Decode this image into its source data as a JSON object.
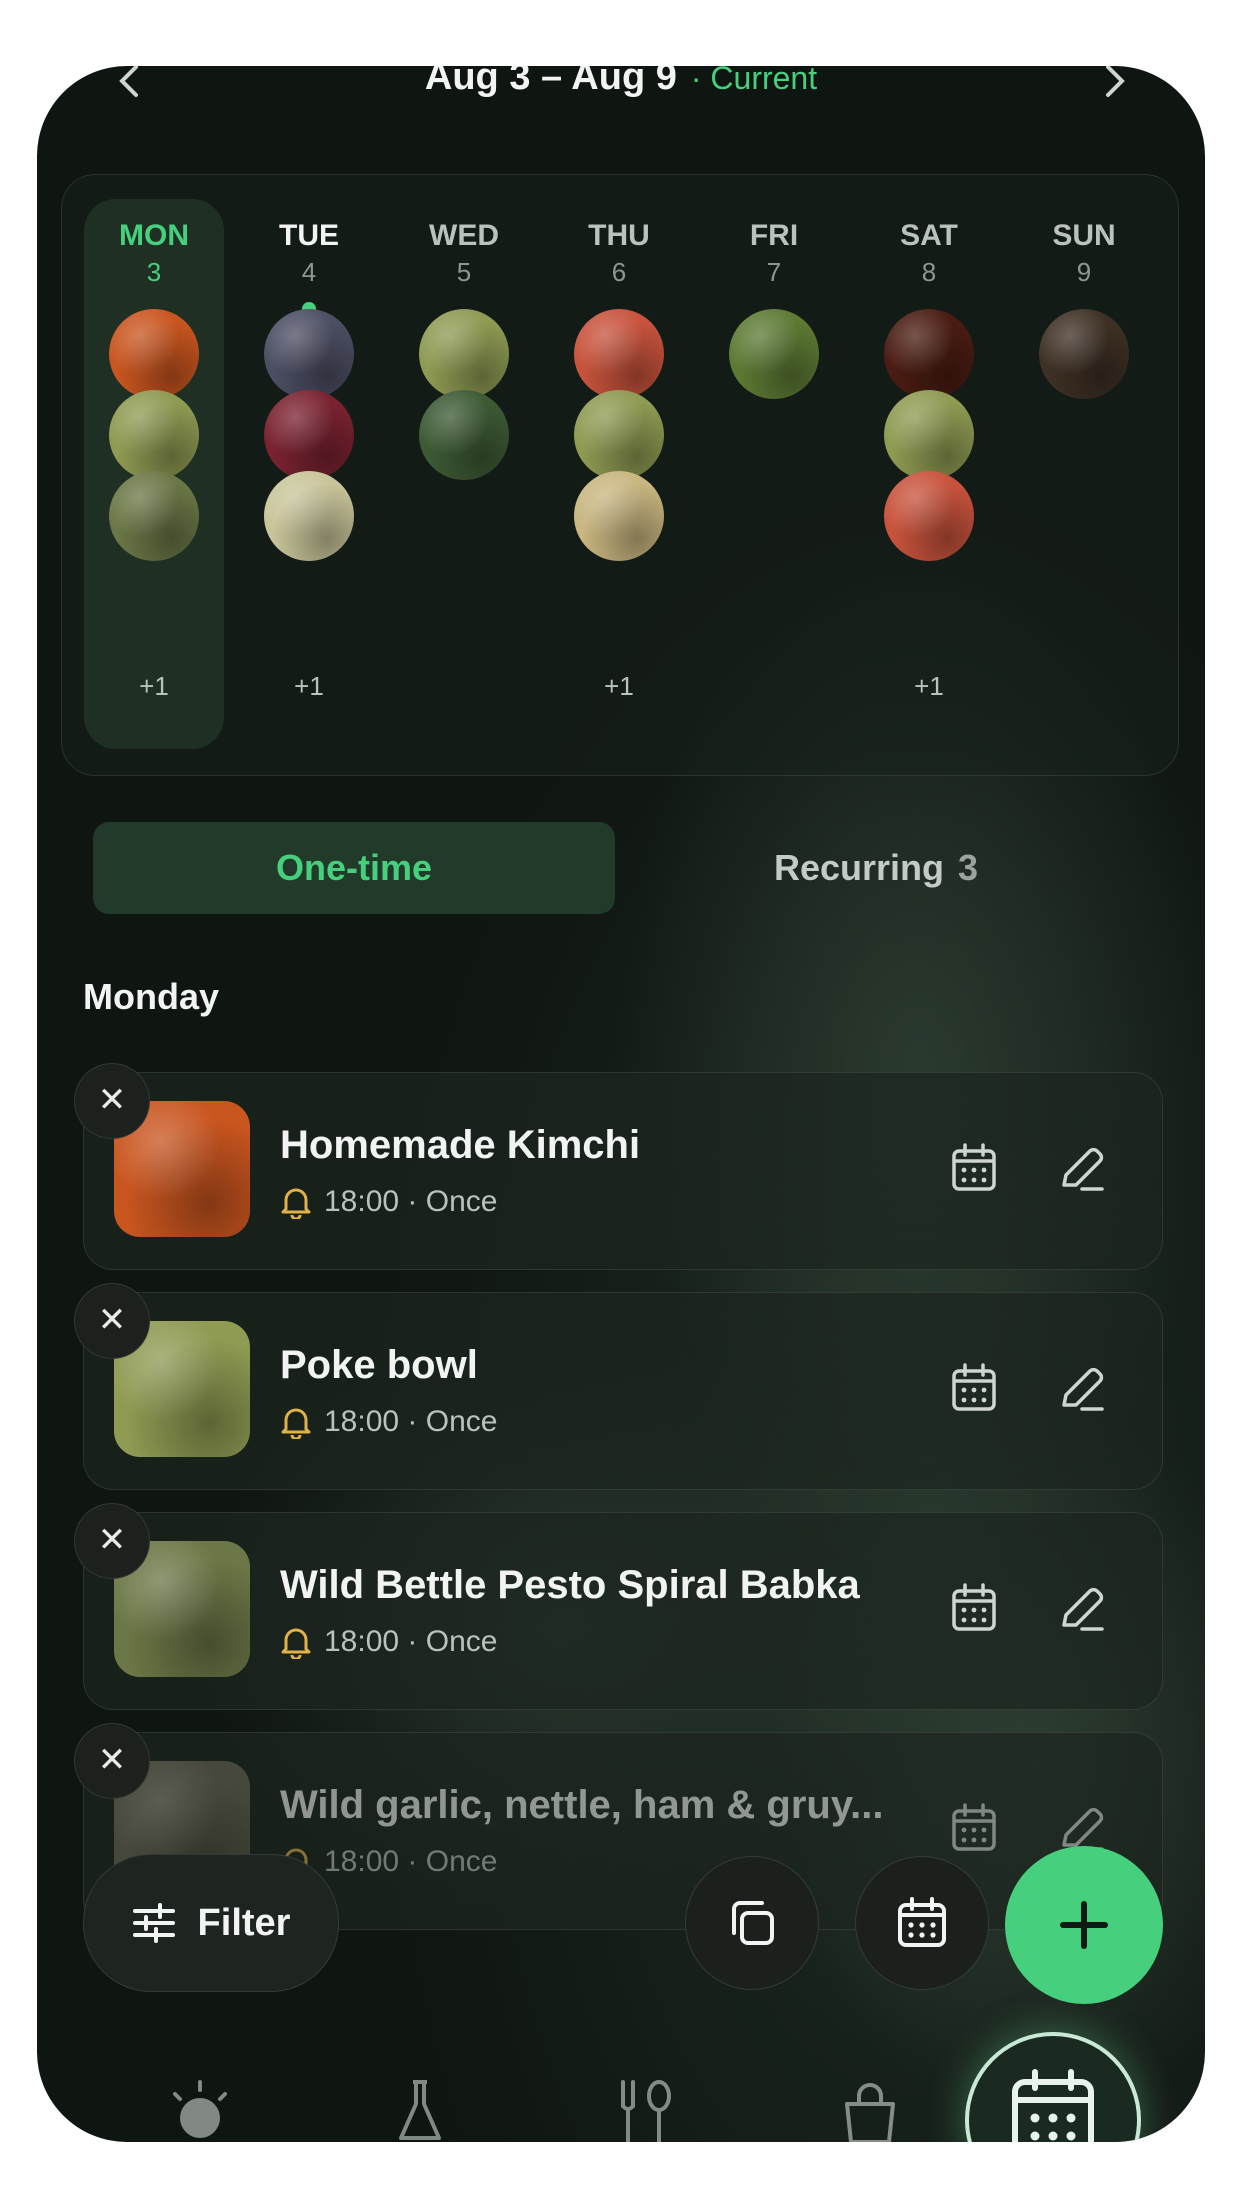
{
  "header": {
    "prev_icon": "chevron-left-icon",
    "next_icon": "chevron-right-icon",
    "range": "Aug 3 – Aug 9",
    "status": "· Current"
  },
  "week": {
    "days": [
      {
        "name": "MON",
        "num": "3",
        "more": "+1",
        "active": true,
        "today": false,
        "meals": [
          {
            "icon": "kimchi-photo",
            "color": "#c9551f"
          },
          {
            "icon": "poke-bowl-photo",
            "color": "#8f9a52"
          },
          {
            "icon": "babka-photo",
            "color": "#6b7746"
          }
        ]
      },
      {
        "name": "TUE",
        "num": "4",
        "more": "+1",
        "active": false,
        "today": true,
        "meals": [
          {
            "icon": "berry-bowl-photo",
            "color": "#4c4e63"
          },
          {
            "icon": "cranberry-photo",
            "color": "#7a2230"
          },
          {
            "icon": "greens-plate-photo",
            "color": "#c9c59a"
          }
        ]
      },
      {
        "name": "WED",
        "num": "5",
        "more": "",
        "active": false,
        "today": false,
        "meals": [
          {
            "icon": "poke-bowl-photo",
            "color": "#8f9a52"
          },
          {
            "icon": "salad-bowl-photo",
            "color": "#3d5a34"
          }
        ]
      },
      {
        "name": "THU",
        "num": "6",
        "more": "+1",
        "active": false,
        "today": false,
        "meals": [
          {
            "icon": "jars-photo",
            "color": "#c8533c"
          },
          {
            "icon": "poke-bowl-photo",
            "color": "#8f9a52"
          },
          {
            "icon": "golden-milk-photo",
            "color": "#c9b680"
          }
        ]
      },
      {
        "name": "FRI",
        "num": "7",
        "more": "",
        "active": false,
        "today": false,
        "meals": [
          {
            "icon": "broccoli-rice-photo",
            "color": "#5d7a34"
          }
        ]
      },
      {
        "name": "SAT",
        "num": "8",
        "more": "+1",
        "active": false,
        "today": false,
        "meals": [
          {
            "icon": "coffee-beans-photo",
            "color": "#4a1c12"
          },
          {
            "icon": "poke-bowl-photo",
            "color": "#8f9a52"
          },
          {
            "icon": "jars-photo",
            "color": "#c8533c"
          }
        ]
      },
      {
        "name": "SUN",
        "num": "9",
        "more": "",
        "active": false,
        "today": false,
        "meals": [
          {
            "icon": "chocolate-photo",
            "color": "#3e3024"
          }
        ]
      }
    ]
  },
  "tabs": {
    "one_time": "One-time",
    "recurring": "Recurring",
    "recurring_count": "3"
  },
  "section": {
    "day": "Monday"
  },
  "meals": [
    {
      "title": "Homemade Kimchi",
      "time": "18:00 · Once",
      "image": "kimchi-photo",
      "color": "#c9551f"
    },
    {
      "title": "Poke bowl",
      "time": "18:00 · Once",
      "image": "poke-bowl-photo",
      "color": "#8f9a52"
    },
    {
      "title": "Wild Bettle Pesto Spiral Babka",
      "time": "18:00 · Once",
      "image": "babka-photo",
      "color": "#6b7746"
    },
    {
      "title": "Wild garlic, nettle, ham & gruy...",
      "time": "18:00 · Once",
      "image": "flatbread-photo",
      "color": "#6f6a58"
    }
  ],
  "actions": {
    "filter_label": "Filter",
    "copy_icon": "copy-icon",
    "calendar_icon": "calendar-icon",
    "add_icon": "plus-icon"
  },
  "colors": {
    "accent": "#46d07e",
    "reminder": "#e0b24a",
    "background": "#101612"
  },
  "bottom_nav": [
    "sun-icon",
    "flask-icon",
    "fork-spoon-icon",
    "shopping-bag-icon",
    "calendar-plan-icon"
  ]
}
